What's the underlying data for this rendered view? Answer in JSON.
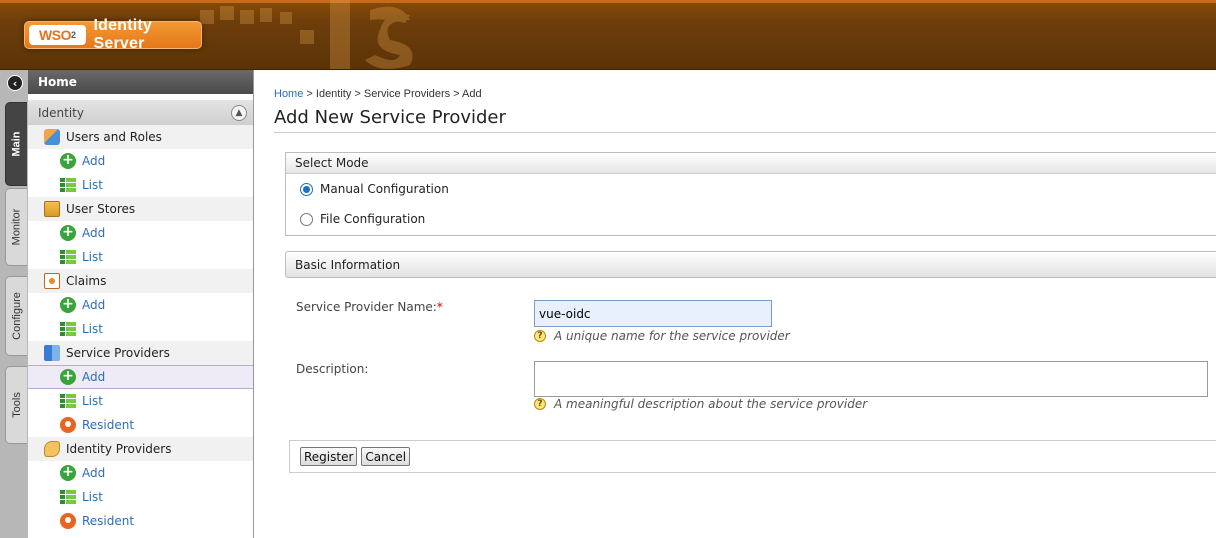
{
  "header": {
    "logo_wso": "WSO",
    "logo_sub": "2",
    "product_name": "Identity Server"
  },
  "vertical_tabs": [
    {
      "label": "Main",
      "active": true
    },
    {
      "label": "Monitor",
      "active": false
    },
    {
      "label": "Configure",
      "active": false
    },
    {
      "label": "Tools",
      "active": false
    }
  ],
  "sidebar": {
    "home_label": "Home",
    "section_label": "Identity",
    "categories": [
      {
        "label": "Users and Roles",
        "icon": "users-roles-icon",
        "items": [
          {
            "label": "Add",
            "icon": "add-icon"
          },
          {
            "label": "List",
            "icon": "list-icon"
          }
        ]
      },
      {
        "label": "User Stores",
        "icon": "user-stores-icon",
        "items": [
          {
            "label": "Add",
            "icon": "add-icon"
          },
          {
            "label": "List",
            "icon": "list-icon"
          }
        ]
      },
      {
        "label": "Claims",
        "icon": "claims-icon",
        "items": [
          {
            "label": "Add",
            "icon": "add-icon"
          },
          {
            "label": "List",
            "icon": "list-icon"
          }
        ]
      },
      {
        "label": "Service Providers",
        "icon": "service-providers-icon",
        "items": [
          {
            "label": "Add",
            "icon": "add-icon",
            "selected": true
          },
          {
            "label": "List",
            "icon": "list-icon"
          },
          {
            "label": "Resident",
            "icon": "resident-icon"
          }
        ]
      },
      {
        "label": "Identity Providers",
        "icon": "identity-providers-icon",
        "items": [
          {
            "label": "Add",
            "icon": "add-icon"
          },
          {
            "label": "List",
            "icon": "list-icon"
          },
          {
            "label": "Resident",
            "icon": "resident-icon"
          }
        ]
      }
    ]
  },
  "main": {
    "breadcrumb": [
      "Home",
      "Identity",
      "Service Providers",
      "Add"
    ],
    "breadcrumb_separator": " > ",
    "title": "Add New Service Provider",
    "select_mode": {
      "heading": "Select Mode",
      "options": [
        {
          "label": "Manual Configuration",
          "checked": true
        },
        {
          "label": "File Configuration",
          "checked": false
        }
      ]
    },
    "basic_info": {
      "heading": "Basic Information",
      "sp_name_label": "Service Provider Name:",
      "required_mark": "*",
      "sp_name_value": "vue-oidc",
      "sp_name_hint": "A unique name for the service provider",
      "description_label": "Description:",
      "description_value": "",
      "description_hint": "A meaningful description about the service provider"
    },
    "buttons": {
      "register": "Register",
      "cancel": "Cancel"
    }
  },
  "colors": {
    "header_brown": "#6e3e0a",
    "logo_orange": "#e5771a",
    "link_blue": "#2a6ebb",
    "selected_row": "#eeebf6",
    "radio_blue": "#1d6fc2"
  }
}
